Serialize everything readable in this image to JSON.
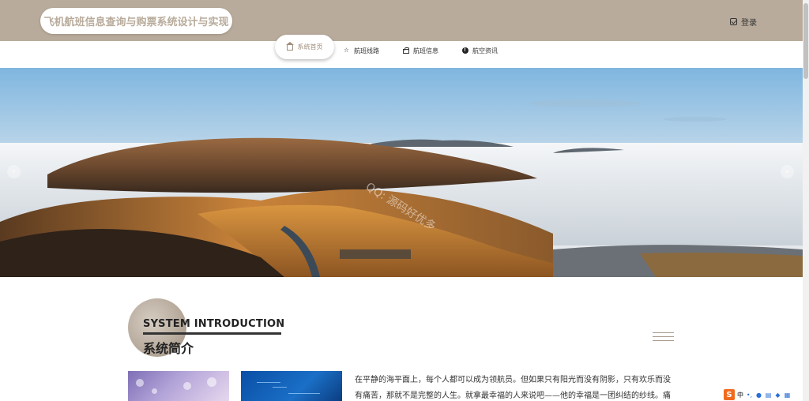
{
  "header": {
    "site_title": "飞机航班信息查询与购票系统设计与实现",
    "login_label": "登录"
  },
  "nav": {
    "items": [
      {
        "label": "系统首页",
        "icon": "home-icon",
        "active": true
      },
      {
        "label": "航班线路",
        "icon": "star-icon",
        "active": false
      },
      {
        "label": "航班信息",
        "icon": "bag-icon",
        "active": false
      },
      {
        "label": "航空资讯",
        "icon": "info-icon",
        "active": false
      }
    ]
  },
  "banner": {
    "watermark": "QQ: 源码好优多",
    "prev_icon": "chevron-left-icon",
    "next_icon": "chevron-right-icon"
  },
  "intro": {
    "title_en": "SYSTEM INTRODUCTION",
    "title_cn": "系统简介",
    "text": "在平静的海平面上，每个人都可以成为领航员。但如果只有阳光而没有阴影，只有欢乐而没有痛苦，那就不是完整的人生。就拿最幸福的人来说吧——他的幸福是一团纠结的纱线。痛苦和幸"
  },
  "ime": {
    "logo": "S",
    "lang": "中"
  },
  "colors": {
    "header_bg": "#b8ab9b",
    "accent": "#a08d7b",
    "title_text": "#b8ab9b"
  }
}
